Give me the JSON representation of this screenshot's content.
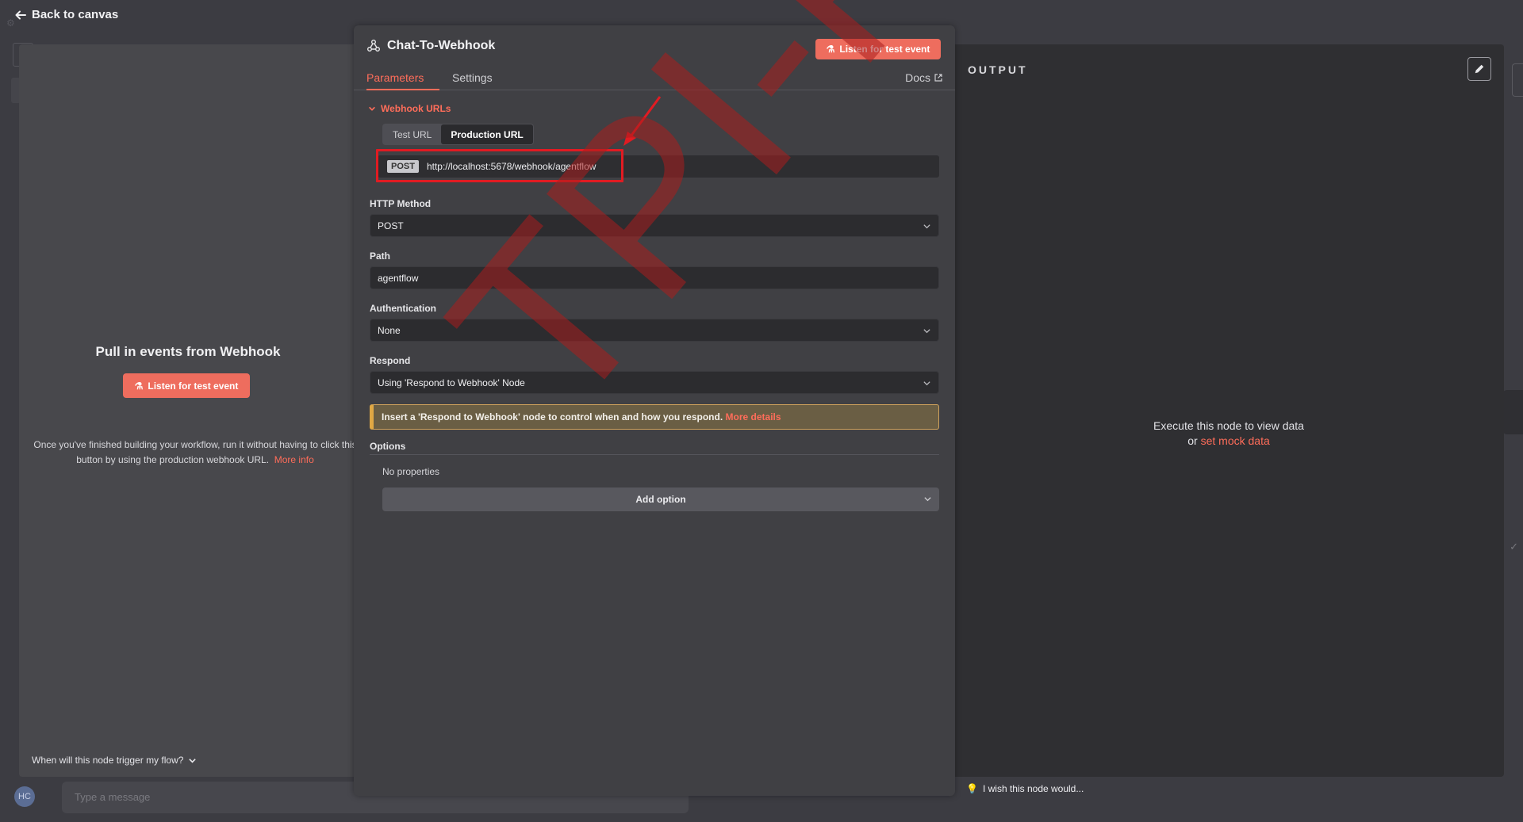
{
  "nav": {
    "back_label": "Back to canvas"
  },
  "input_panel": {
    "title": "Pull in events from Webhook",
    "listen_button": "Listen for test event",
    "note": "Once you've finished building your workflow, run it without having to click this button by using the production webhook URL.",
    "more_info_link": "More info",
    "trigger_question": "When will this node trigger my flow?"
  },
  "node": {
    "title": "Chat-To-Webhook",
    "listen_button": "Listen for test event",
    "tabs": [
      {
        "label": "Parameters",
        "active": true
      },
      {
        "label": "Settings",
        "active": false
      }
    ],
    "docs_label": "Docs",
    "webhook_urls": {
      "section_label": "Webhook URLs",
      "toggle_options": [
        "Test URL",
        "Production URL"
      ],
      "selected": "Production URL",
      "method": "POST",
      "url": "http://localhost:5678/webhook/agentflow"
    },
    "fields": {
      "http_method": {
        "label": "HTTP Method",
        "value": "POST"
      },
      "path": {
        "label": "Path",
        "value": "agentflow"
      },
      "authentication": {
        "label": "Authentication",
        "value": "None"
      },
      "respond": {
        "label": "Respond",
        "value": "Using 'Respond to Webhook' Node"
      }
    },
    "notice": {
      "text": "Insert a 'Respond to Webhook' node to control when and how you respond.",
      "link": "More details"
    },
    "options": {
      "label": "Options",
      "empty_text": "No properties",
      "add_button": "Add option"
    }
  },
  "output_panel": {
    "label": "OUTPUT",
    "message_line1": "Execute this node to view data",
    "message_or": "or",
    "mock_link": "set mock data",
    "wish_label": "I wish this node would..."
  },
  "background": {
    "avatar_initials": "HC",
    "chat_placeholder": "Type a message"
  },
  "watermark_text": "TPI-Roger",
  "colors": {
    "accent": "#ff6d5a",
    "button_bg": "#ee6d5e",
    "highlight": "#e11b22",
    "notice_border": "#e0a844"
  }
}
